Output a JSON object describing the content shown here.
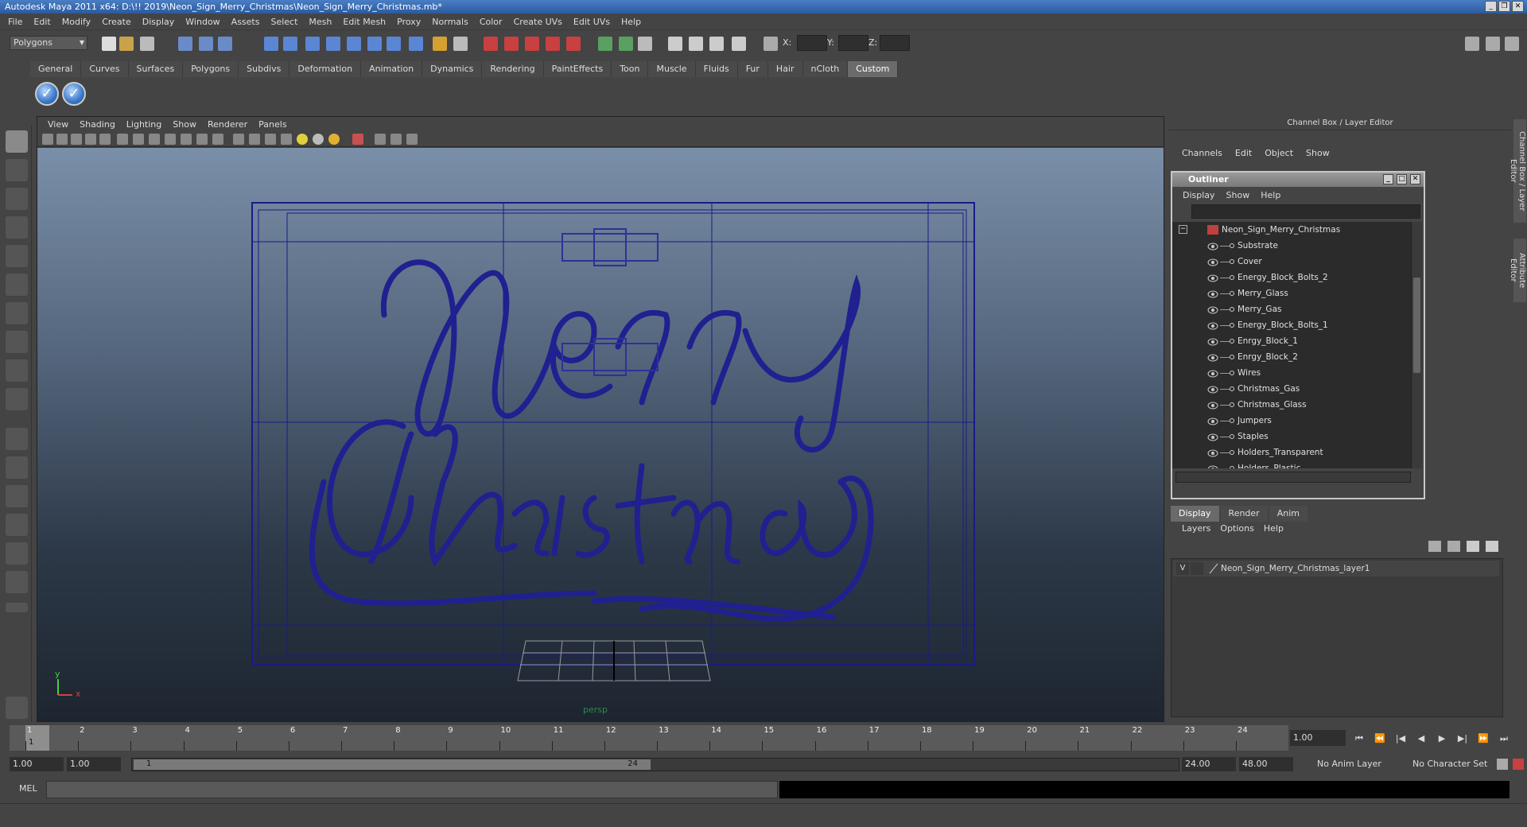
{
  "window": {
    "title": "Autodesk Maya 2011 x64: D:\\!! 2019\\Neon_Sign_Merry_Christmas\\Neon_Sign_Merry_Christmas.mb*"
  },
  "menubar": [
    "File",
    "Edit",
    "Modify",
    "Create",
    "Display",
    "Window",
    "Assets",
    "Select",
    "Mesh",
    "Edit Mesh",
    "Proxy",
    "Normals",
    "Color",
    "Create UVs",
    "Edit UVs",
    "Help"
  ],
  "status": {
    "mode": "Polygons",
    "x_label": "X:",
    "y_label": "Y:",
    "z_label": "Z:"
  },
  "shelf": {
    "tabs": [
      "General",
      "Curves",
      "Surfaces",
      "Polygons",
      "Subdivs",
      "Deformation",
      "Animation",
      "Dynamics",
      "Rendering",
      "PaintEffects",
      "Toon",
      "Muscle",
      "Fluids",
      "Fur",
      "Hair",
      "nCloth",
      "Custom"
    ],
    "active_tab": "Custom",
    "buttons": [
      "check-icon",
      "check-icon"
    ]
  },
  "viewport": {
    "menu": [
      "View",
      "Shading",
      "Lighting",
      "Show",
      "Renderer",
      "Panels"
    ],
    "camera_label": "persp",
    "axis_y": "y",
    "axis_x": "x"
  },
  "channel_box": {
    "title": "Channel Box / Layer Editor",
    "menu": [
      "Channels",
      "Edit",
      "Object",
      "Show"
    ]
  },
  "outliner": {
    "title": "Outliner",
    "menu": [
      "Display",
      "Show",
      "Help"
    ],
    "root": "Neon_Sign_Merry_Christmas",
    "items": [
      "Substrate",
      "Cover",
      "Energy_Block_Bolts_2",
      "Merry_Glass",
      "Merry_Gas",
      "Energy_Block_Bolts_1",
      "Enrgy_Block_1",
      "Enrgy_Block_2",
      "Wires",
      "Christmas_Gas",
      "Christmas_Glass",
      "Jumpers",
      "Staples",
      "Holders_Transparent",
      "Holders_Plastic"
    ]
  },
  "layer_editor": {
    "tabs": [
      "Display",
      "Render",
      "Anim"
    ],
    "active_tab": "Display",
    "menu": [
      "Layers",
      "Options",
      "Help"
    ],
    "layer_visible": "V",
    "layer_name": "Neon_Sign_Merry_Christmas_layer1"
  },
  "side_tabs": [
    "Channel Box / Layer Editor",
    "Attribute Editor"
  ],
  "timeline": {
    "frames": [
      "1",
      "2",
      "3",
      "4",
      "5",
      "6",
      "7",
      "8",
      "9",
      "10",
      "11",
      "12",
      "13",
      "14",
      "15",
      "16",
      "17",
      "18",
      "19",
      "20",
      "21",
      "22",
      "23",
      "24"
    ],
    "current_frame": "1.00",
    "current_marker": "1"
  },
  "range": {
    "start": "1.00",
    "anim_start": "1.00",
    "range_start": "1",
    "range_end": "24",
    "anim_end": "24.00",
    "end": "48.00",
    "anim_layer": "No Anim Layer",
    "character_set": "No Character Set"
  },
  "command_line": {
    "label": "MEL"
  }
}
